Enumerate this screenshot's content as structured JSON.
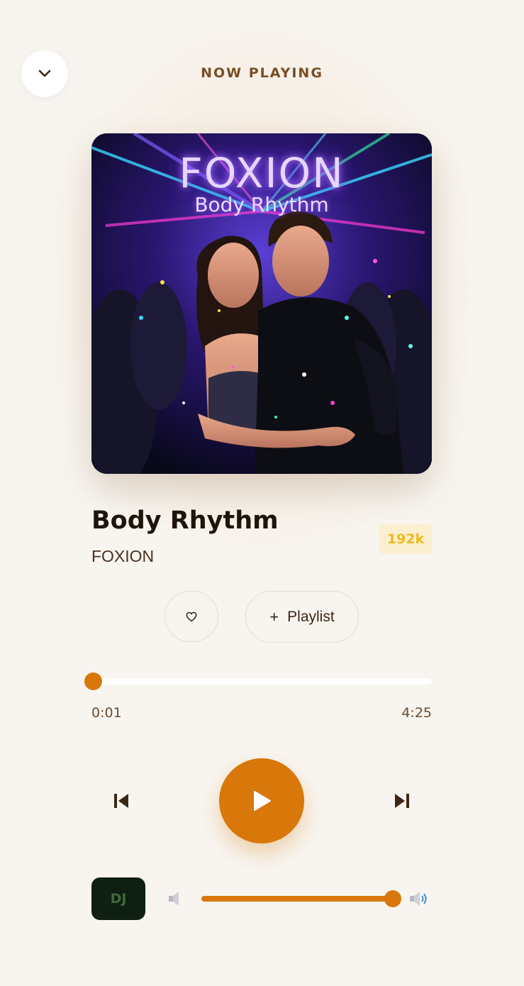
{
  "header": {
    "title": "NOW PLAYING",
    "collapse_icon": "chevron-down-icon"
  },
  "album_art": {
    "title_text": "FOXION",
    "subtitle_text": "Body Rhythm"
  },
  "track": {
    "title": "Body Rhythm",
    "artist": "FOXION",
    "quality_badge": "192k"
  },
  "actions": {
    "like_icon": "heart-outline-icon",
    "playlist_label": "Playlist",
    "playlist_icon": "plus-icon"
  },
  "progress": {
    "current_time": "0:01",
    "total_time": "4:25",
    "position_fraction": 0.004
  },
  "controls": {
    "previous_icon": "skip-previous-icon",
    "play_icon": "play-icon",
    "next_icon": "skip-next-icon"
  },
  "bottom": {
    "dj_label": "DJ",
    "volume_low_icon": "volume-low-icon",
    "volume_high_icon": "volume-high-icon",
    "volume_fraction": 1.0
  },
  "colors": {
    "accent": "#d8770a",
    "background": "#f8f5f0",
    "badge_bg": "#fbefd0",
    "badge_text": "#f0b91b",
    "dj_bg": "#0f1f12"
  }
}
